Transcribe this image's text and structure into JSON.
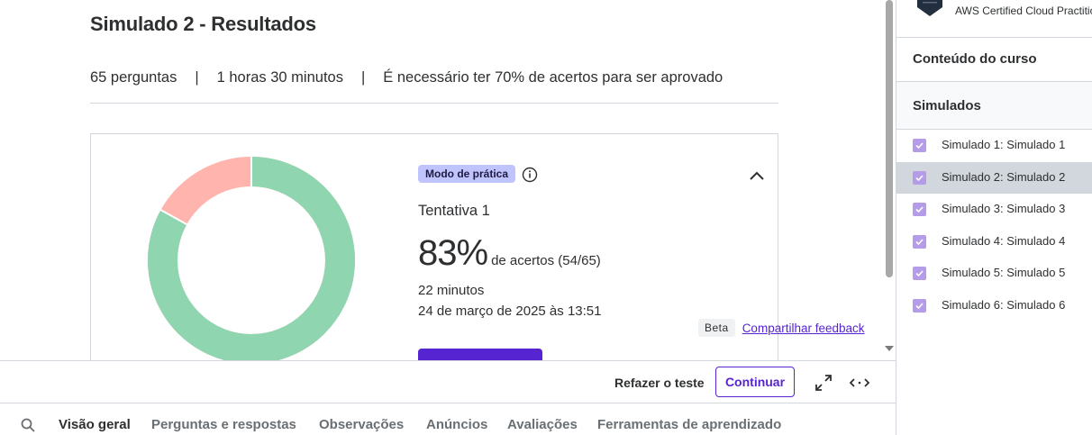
{
  "title": "Simulado 2 - Resultados",
  "meta": {
    "questions": "65 perguntas",
    "separator": "|",
    "duration": "1 horas 30 minutos",
    "pass_requirement": "É necessário ter 70% de acertos para ser aprovado"
  },
  "result": {
    "mode_badge": "Modo de prática",
    "attempt": "Tentativa 1",
    "score_pct": "83%",
    "score_detail": "de acertos (54/65)",
    "time_taken": "22 minutos",
    "date": "24 de março de 2025 às 13:51",
    "correct": 54,
    "incorrect": 11,
    "total": 65,
    "colors": {
      "correct": "#8fd6b0",
      "incorrect": "#ffb5ad"
    }
  },
  "feedback": {
    "beta": "Beta",
    "link": "Compartilhar feedback"
  },
  "actions": {
    "retake": "Refazer o teste",
    "continue": "Continuar"
  },
  "tabs": [
    {
      "label": "Visão geral",
      "active": true
    },
    {
      "label": "Perguntas e respostas",
      "active": false
    },
    {
      "label": "Observações",
      "active": false
    },
    {
      "label": "Anúncios",
      "active": false
    },
    {
      "label": "Avaliações",
      "active": false
    },
    {
      "label": "Ferramentas de aprendizado",
      "active": false
    }
  ],
  "sidebar": {
    "cert_name": "AWS Certified Cloud Practitioner",
    "course_content": "Conteúdo do curso",
    "section_title": "Simulados",
    "items": [
      {
        "label": "Simulado 1: Simulado 1",
        "checked": true,
        "active": false
      },
      {
        "label": "Simulado 2: Simulado 2",
        "checked": true,
        "active": true
      },
      {
        "label": "Simulado 3: Simulado 3",
        "checked": true,
        "active": false
      },
      {
        "label": "Simulado 4: Simulado 4",
        "checked": true,
        "active": false
      },
      {
        "label": "Simulado 5: Simulado 5",
        "checked": true,
        "active": false
      },
      {
        "label": "Simulado 6: Simulado 6",
        "checked": true,
        "active": false
      }
    ]
  },
  "colors": {
    "accent": "#5624d0",
    "badge_bg": "#c0c4fc",
    "checkbox": "#b59ce8"
  }
}
